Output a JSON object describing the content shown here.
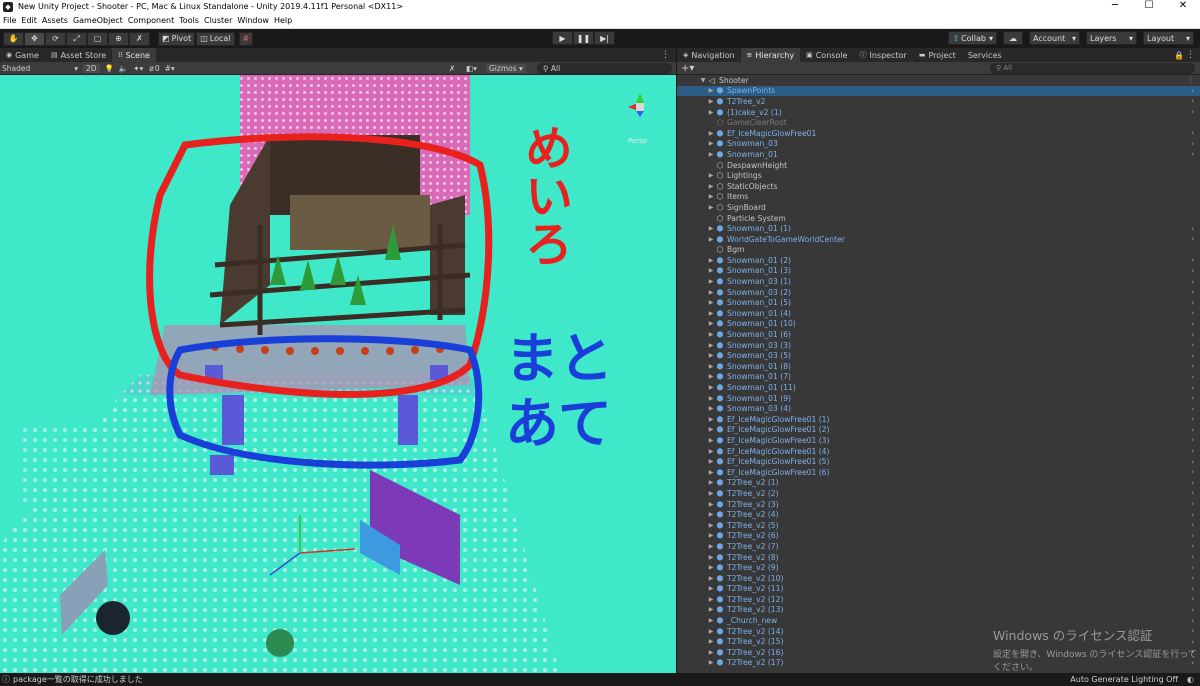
{
  "window": {
    "title": "New Unity Project - Shooter - PC, Mac & Linux Standalone - Unity 2019.4.11f1 Personal <DX11>",
    "minimize": "─",
    "maximize": "☐",
    "close": "✕"
  },
  "menu": [
    "File",
    "Edit",
    "Assets",
    "GameObject",
    "Component",
    "Tools",
    "Cluster",
    "Window",
    "Help"
  ],
  "toolbar": {
    "pivot": "Pivot",
    "local": "Local",
    "collab": "Collab",
    "account": "Account",
    "layers": "Layers",
    "layout": "Layout"
  },
  "scene_tabs": [
    {
      "label": "Game",
      "icon": "gamepad-icon"
    },
    {
      "label": "Asset Store",
      "icon": "store-icon"
    },
    {
      "label": "Scene",
      "icon": "grid-icon"
    }
  ],
  "scene_toolbar": {
    "shading": "Shaded",
    "mode_2d": "2D",
    "hidden_count": "0",
    "gizmos": "Gizmos",
    "search_placeholder": "All"
  },
  "scene_annotations": {
    "top_label": "めいろ",
    "bottom_label_line1": "まと",
    "bottom_label_line2": "あて",
    "gizmo_view": "Persp"
  },
  "right_tabs": [
    "Navigation",
    "Hierarchy",
    "Console",
    "Inspector",
    "Project",
    "Services"
  ],
  "hierarchy": {
    "search_placeholder": "All",
    "root": "Shooter",
    "items": [
      {
        "label": "SpawnPoints",
        "type": "prefab",
        "selected": true,
        "expand": true
      },
      {
        "label": "T2Tree_v2",
        "type": "prefab",
        "expand": true
      },
      {
        "label": "(1)cake_v2 (1)",
        "type": "prefab",
        "expand": true
      },
      {
        "label": "GameClearRoot",
        "type": "disabled",
        "expand": false
      },
      {
        "label": "Ef_IceMagicGlowFree01",
        "type": "prefab",
        "expand": true
      },
      {
        "label": "Snowman_03",
        "type": "prefab",
        "expand": true
      },
      {
        "label": "Snowman_01",
        "type": "prefab",
        "expand": true
      },
      {
        "label": "DespawnHeight",
        "type": "plain",
        "expand": false
      },
      {
        "label": "Lightings",
        "type": "plain",
        "expand": true
      },
      {
        "label": "StaticObjects",
        "type": "plain",
        "expand": true
      },
      {
        "label": "Items",
        "type": "plain",
        "expand": true
      },
      {
        "label": "SignBoard",
        "type": "plain",
        "expand": true
      },
      {
        "label": "Particle System",
        "type": "plain",
        "expand": false
      },
      {
        "label": "Snowman_01 (1)",
        "type": "prefab",
        "expand": true
      },
      {
        "label": "WorldGateToGameWorldCenter",
        "type": "prefab",
        "expand": true
      },
      {
        "label": "Bgm",
        "type": "plain",
        "expand": false
      },
      {
        "label": "Snowman_01 (2)",
        "type": "prefab",
        "expand": true
      },
      {
        "label": "Snowman_01 (3)",
        "type": "prefab",
        "expand": true
      },
      {
        "label": "Snowman_03 (1)",
        "type": "prefab",
        "expand": true
      },
      {
        "label": "Snowman_03 (2)",
        "type": "prefab",
        "expand": true
      },
      {
        "label": "Snowman_01 (5)",
        "type": "prefab",
        "expand": true
      },
      {
        "label": "Snowman_01 (4)",
        "type": "prefab",
        "expand": true
      },
      {
        "label": "Snowman_01 (10)",
        "type": "prefab",
        "expand": true
      },
      {
        "label": "Snowman_01 (6)",
        "type": "prefab",
        "expand": true
      },
      {
        "label": "Snowman_03 (3)",
        "type": "prefab",
        "expand": true
      },
      {
        "label": "Snowman_03 (5)",
        "type": "prefab",
        "expand": true
      },
      {
        "label": "Snowman_01 (8)",
        "type": "prefab",
        "expand": true
      },
      {
        "label": "Snowman_01 (7)",
        "type": "prefab",
        "expand": true
      },
      {
        "label": "Snowman_01 (11)",
        "type": "prefab",
        "expand": true
      },
      {
        "label": "Snowman_01 (9)",
        "type": "prefab",
        "expand": true
      },
      {
        "label": "Snowman_03 (4)",
        "type": "prefab",
        "expand": true
      },
      {
        "label": "Ef_IceMagicGlowFree01 (1)",
        "type": "prefab",
        "expand": true
      },
      {
        "label": "Ef_IceMagicGlowFree01 (2)",
        "type": "prefab",
        "expand": true
      },
      {
        "label": "Ef_IceMagicGlowFree01 (3)",
        "type": "prefab",
        "expand": true
      },
      {
        "label": "Ef_IceMagicGlowFree01 (4)",
        "type": "prefab",
        "expand": true
      },
      {
        "label": "Ef_IceMagicGlowFree01 (5)",
        "type": "prefab",
        "expand": true
      },
      {
        "label": "Ef_IceMagicGlowFree01 (6)",
        "type": "prefab",
        "expand": true
      },
      {
        "label": "T2Tree_v2 (1)",
        "type": "prefab",
        "expand": true
      },
      {
        "label": "T2Tree_v2 (2)",
        "type": "prefab",
        "expand": true
      },
      {
        "label": "T2Tree_v2 (3)",
        "type": "prefab",
        "expand": true
      },
      {
        "label": "T2Tree_v2 (4)",
        "type": "prefab",
        "expand": true
      },
      {
        "label": "T2Tree_v2 (5)",
        "type": "prefab",
        "expand": true
      },
      {
        "label": "T2Tree_v2 (6)",
        "type": "prefab",
        "expand": true
      },
      {
        "label": "T2Tree_v2 (7)",
        "type": "prefab",
        "expand": true
      },
      {
        "label": "T2Tree_v2 (8)",
        "type": "prefab",
        "expand": true
      },
      {
        "label": "T2Tree_v2 (9)",
        "type": "prefab",
        "expand": true
      },
      {
        "label": "T2Tree_v2 (10)",
        "type": "prefab",
        "expand": true
      },
      {
        "label": "T2Tree_v2 (11)",
        "type": "prefab",
        "expand": true
      },
      {
        "label": "T2Tree_v2 (12)",
        "type": "prefab",
        "expand": true
      },
      {
        "label": "T2Tree_v2 (13)",
        "type": "prefab",
        "expand": true
      },
      {
        "label": "_Church_new",
        "type": "prefab",
        "expand": true
      },
      {
        "label": "T2Tree_v2 (14)",
        "type": "prefab",
        "expand": true
      },
      {
        "label": "T2Tree_v2 (15)",
        "type": "prefab",
        "expand": true
      },
      {
        "label": "T2Tree_v2 (16)",
        "type": "prefab",
        "expand": true
      },
      {
        "label": "T2Tree_v2 (17)",
        "type": "prefab",
        "expand": true
      }
    ]
  },
  "watermark": {
    "line1": "Windows のライセンス認証",
    "line2": "設定を開き、Windows のライセンス認証を行ってください。"
  },
  "status": {
    "message": "package一覧の取得に成功しました",
    "right": "Auto Generate Lighting Off"
  },
  "colors": {
    "floor": "#3ee8c8",
    "annotation_red": "#e8201e",
    "annotation_blue": "#1a3fd8",
    "selection": "#2c5d87",
    "prefab_text": "#7cb1ea"
  }
}
